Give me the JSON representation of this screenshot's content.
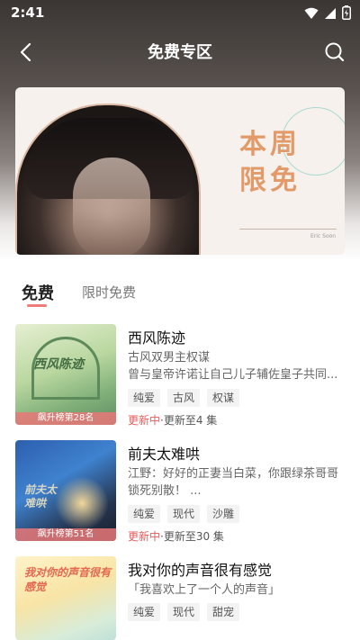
{
  "status_bar": {
    "time": "2:41"
  },
  "nav": {
    "title": "免费专区"
  },
  "banner": {
    "line1": "本周",
    "line2": "限免",
    "signature": "Eric Soon"
  },
  "tabs": [
    {
      "label": "免费",
      "active": true
    },
    {
      "label": "限时免费",
      "active": false
    }
  ],
  "books": [
    {
      "title": "西风陈迹",
      "desc1": "古风双男主权谋",
      "desc2": "曾与皇帝许诺让自己儿子辅佐皇子共同...",
      "tags": [
        "纯爱",
        "古风",
        "权谋"
      ],
      "status_red": "更新中",
      "status_rest": "·更新至4 集",
      "rank": "飙升榜第28名",
      "cover_text": "西风陈迹"
    },
    {
      "title": "前夫太难哄",
      "desc1": "江野：好好的正妻当白菜，你跟绿茶哥哥锁死别散！ ...",
      "desc2": "",
      "tags": [
        "纯爱",
        "现代",
        "沙雕"
      ],
      "status_red": "更新中",
      "status_rest": "·更新至30 集",
      "rank": "飙升榜第51名",
      "cover_text": "前夫太难哄"
    },
    {
      "title": "我对你的声音很有感觉",
      "desc1": "「我喜欢上了一个人的声音」",
      "desc2": "",
      "tags": [
        "纯爱",
        "现代",
        "甜宠"
      ],
      "cover_text": "我对你的声音很有感觉"
    }
  ],
  "colors": {
    "accent": "#e65b5b",
    "banner_text": "#e29a69"
  }
}
